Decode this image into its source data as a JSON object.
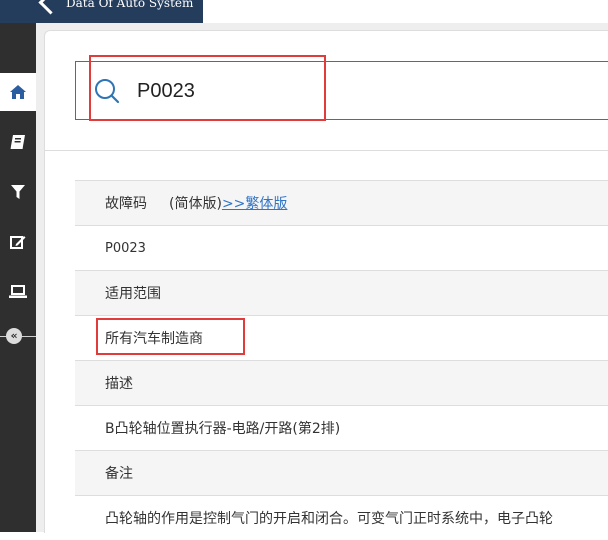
{
  "header": {
    "brand_text": "Data Of Auto System"
  },
  "sidebar": {
    "items": [
      {
        "name": "home-icon",
        "active": true
      },
      {
        "name": "book-icon",
        "active": false
      },
      {
        "name": "filter-icon",
        "active": false
      },
      {
        "name": "edit-icon",
        "active": false
      },
      {
        "name": "laptop-icon",
        "active": false
      }
    ],
    "collapse_glyph": "«"
  },
  "search": {
    "value": "P0023",
    "accent": "#2f74b5"
  },
  "detail": {
    "code_label": "故障码",
    "variant_note": "(简体版)",
    "variant_link": ">>繁体版",
    "code_value": "P0023",
    "scope_label": "适用范围",
    "scope_value": "所有汽车制造商",
    "desc_label": "描述",
    "desc_value": "B凸轮轴位置执行器-电路/开路(第2排)",
    "note_label": "备注",
    "note_value": "凸轮轴的作用是控制气门的开启和闭合。可变气门正时系统中，电子凸轮"
  },
  "colors": {
    "highlight": "#e23b3b",
    "sidebar_bg": "#2f2f2f",
    "brand_bg": "#253d5c",
    "link": "#2f74c5"
  }
}
